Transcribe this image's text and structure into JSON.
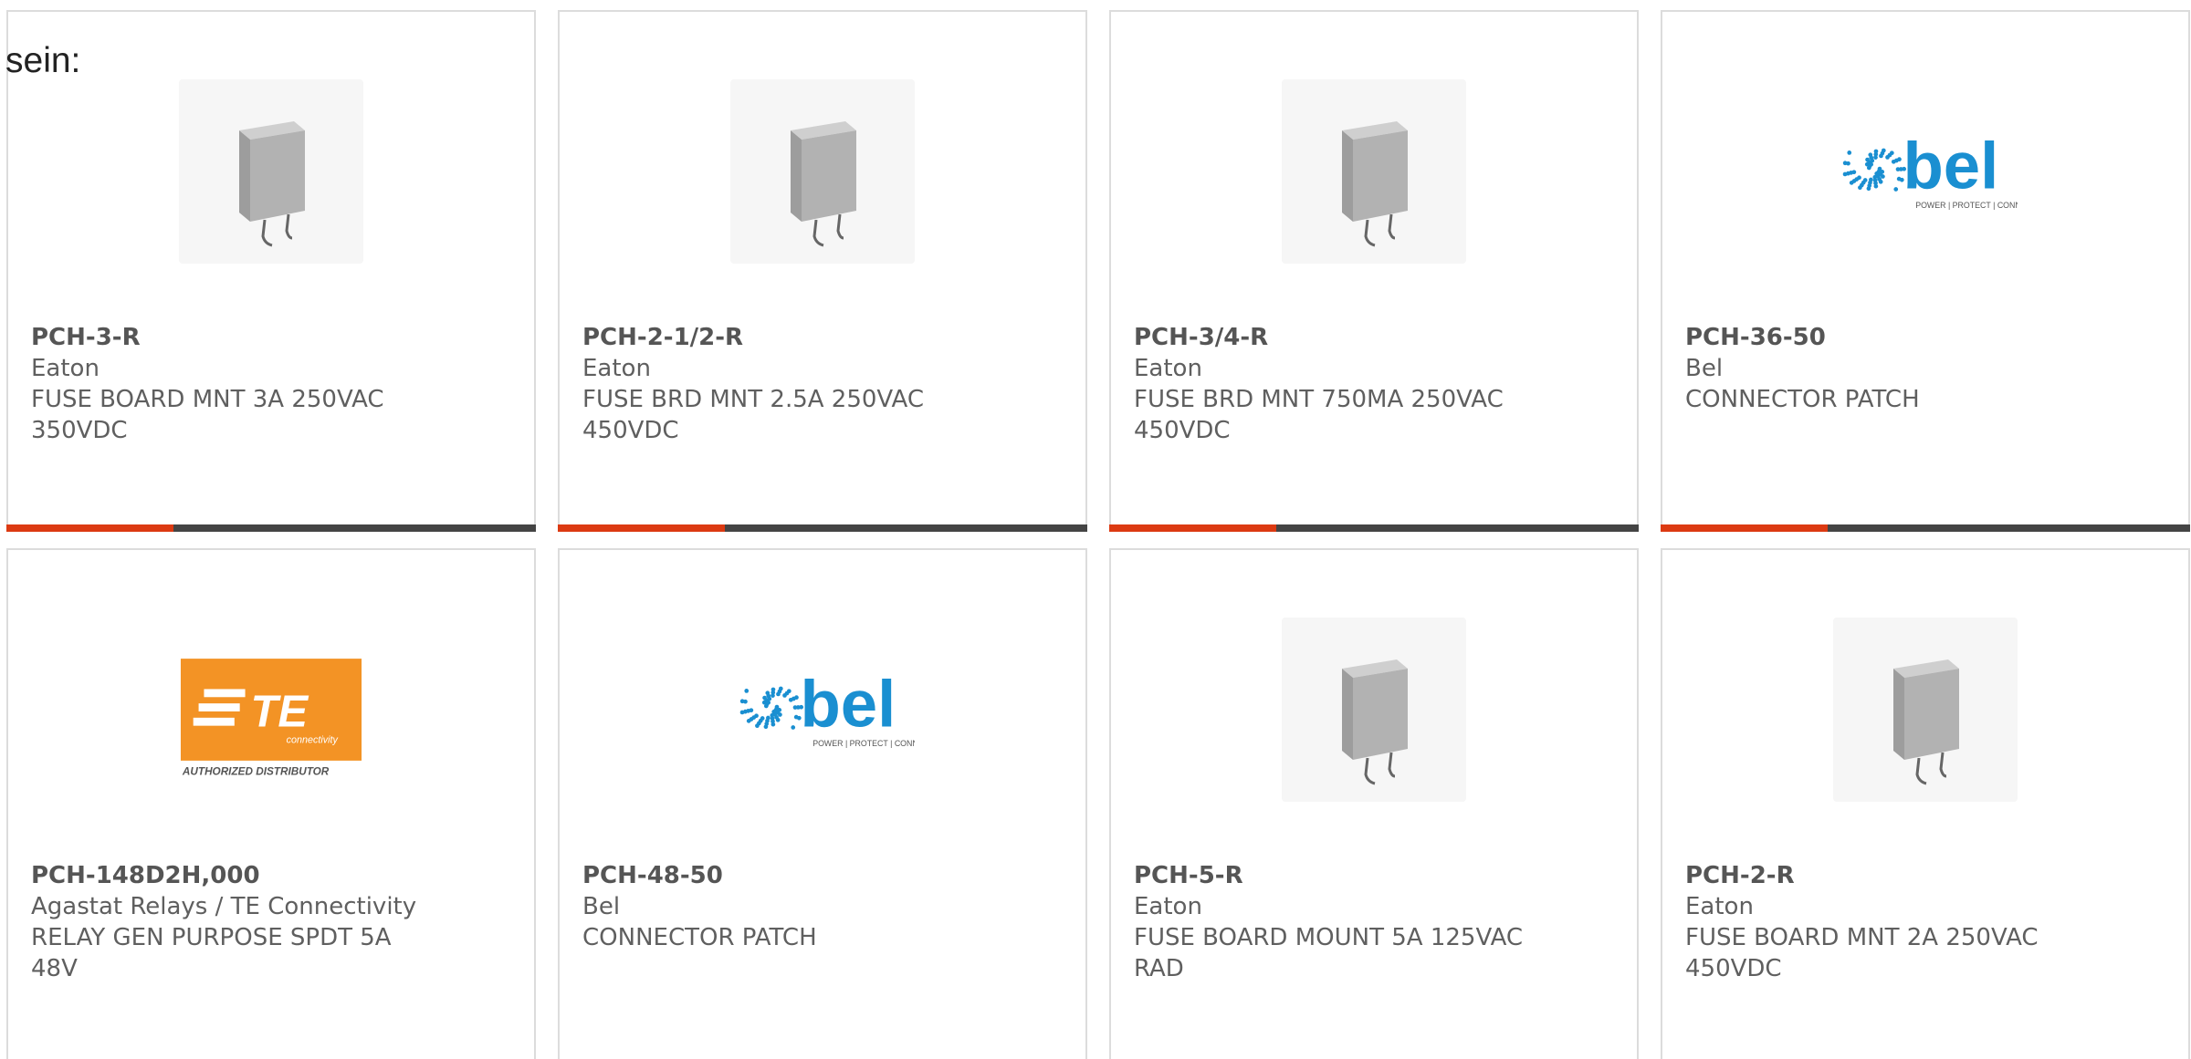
{
  "intro_text": "sein:",
  "products": [
    {
      "part": "PCH-3-R",
      "manufacturer": "Eaton",
      "desc1": "FUSE BOARD MNT 3A 250VAC",
      "desc2": "350VDC",
      "image": "fuse-component-icon"
    },
    {
      "part": "PCH-2-1/2-R",
      "manufacturer": "Eaton",
      "desc1": "FUSE BRD MNT 2.5A 250VAC",
      "desc2": "450VDC",
      "image": "fuse-component-icon"
    },
    {
      "part": "PCH-3/4-R",
      "manufacturer": "Eaton",
      "desc1": "FUSE BRD MNT 750MA 250VAC",
      "desc2": "450VDC",
      "image": "fuse-component-icon"
    },
    {
      "part": "PCH-36-50",
      "manufacturer": "Bel",
      "desc1": "CONNECTOR PATCH",
      "desc2": "",
      "image": "bel-logo"
    },
    {
      "part": "PCH-148D2H,000",
      "manufacturer": "Agastat Relays / TE Connectivity",
      "desc1": "RELAY GEN PURPOSE SPDT 5A",
      "desc2": "48V",
      "image": "te-connectivity-logo"
    },
    {
      "part": "PCH-48-50",
      "manufacturer": "Bel",
      "desc1": "CONNECTOR PATCH",
      "desc2": "",
      "image": "bel-logo"
    },
    {
      "part": "PCH-5-R",
      "manufacturer": "Eaton",
      "desc1": "FUSE BOARD MOUNT 5A 125VAC",
      "desc2": "RAD",
      "image": "fuse-component-icon"
    },
    {
      "part": "PCH-2-R",
      "manufacturer": "Eaton",
      "desc1": "FUSE BOARD MNT 2A 250VAC",
      "desc2": "450VDC",
      "image": "fuse-component-icon"
    }
  ],
  "logos": {
    "bel": {
      "wordmark": "bel",
      "tagline": "POWER | PROTECT | CONNECT"
    },
    "te": {
      "wordmark": "TE",
      "sub": "connectivity",
      "badge": "AUTHORIZED DISTRIBUTOR"
    }
  },
  "colors": {
    "accent": "#dc3a12",
    "bar": "#444444",
    "border": "#dcdcdc",
    "bel_blue": "#1a8fd1",
    "te_orange": "#f39325"
  }
}
